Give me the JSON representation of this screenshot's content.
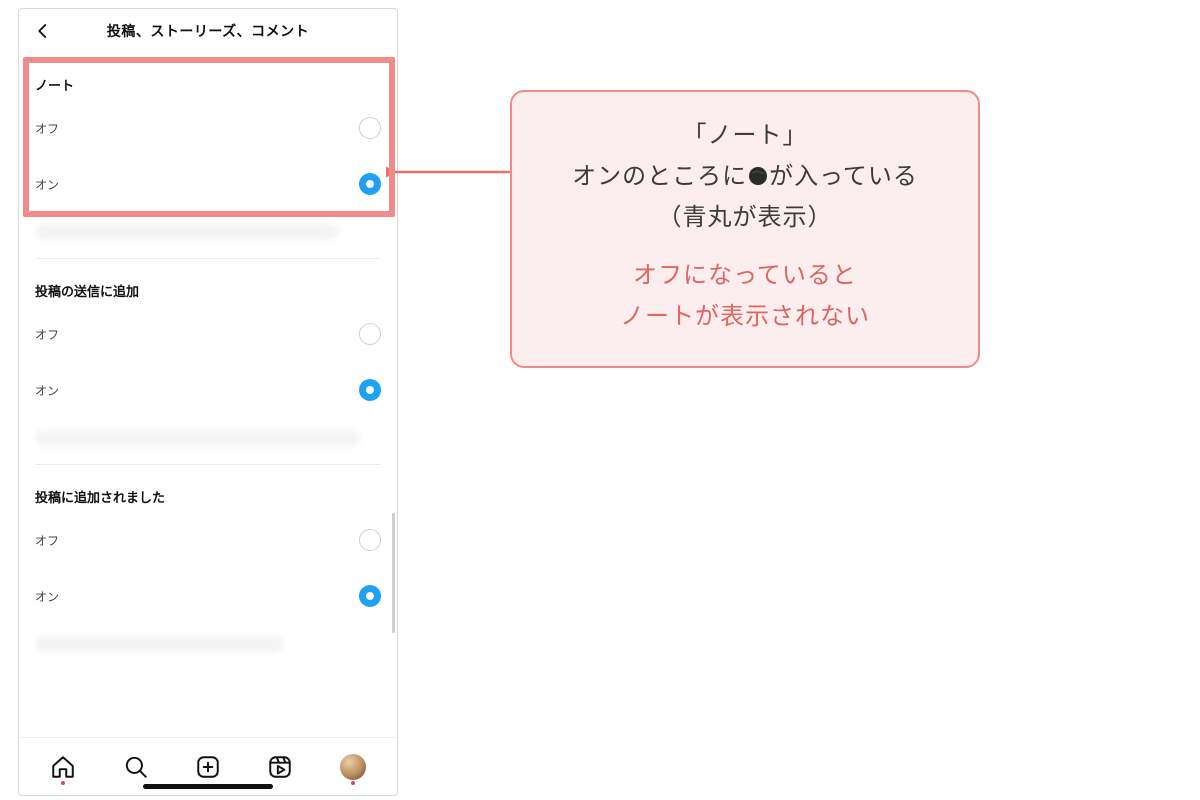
{
  "header": {
    "title": "投稿、ストーリーズ、コメント"
  },
  "sections": [
    {
      "title": "ノート",
      "options": [
        {
          "label": "オフ",
          "selected": false
        },
        {
          "label": "オン",
          "selected": true
        }
      ]
    },
    {
      "title": "投稿の送信に追加",
      "options": [
        {
          "label": "オフ",
          "selected": false
        },
        {
          "label": "オン",
          "selected": true
        }
      ]
    },
    {
      "title": "投稿に追加されました",
      "options": [
        {
          "label": "オフ",
          "selected": false
        },
        {
          "label": "オン",
          "selected": true
        }
      ]
    }
  ],
  "nav": {
    "items": [
      "home",
      "search",
      "create",
      "reels",
      "profile"
    ]
  },
  "annotation": {
    "line1": "「ノート」",
    "line2_pre": "オンのところに",
    "line2_post": "が入っている",
    "line3": "（青丸が表示）",
    "warn1": "オフになっていると",
    "warn2": "ノートが表示されない"
  },
  "colors": {
    "accent": "#1da1f2",
    "highlight_border": "#ef8b8b",
    "callout_bg": "#fceeee",
    "warn_text": "#e0655f"
  }
}
